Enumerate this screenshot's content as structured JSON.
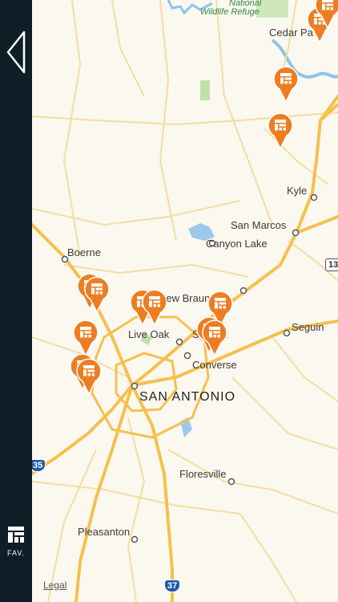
{
  "sidebar": {
    "fav_label": "FAV."
  },
  "map": {
    "places": {
      "wildlife": [
        "National",
        "Wildlife Refuge"
      ],
      "cedar_park": "Cedar Pa",
      "kyle": "Kyle",
      "san_marcos": "San Marcos",
      "canyon_lake": "Canyon Lake",
      "boerne": "Boerne",
      "new_braunfels": "New Braunfels",
      "seguin": "Seguin",
      "live_oak": "Live Oak",
      "schertz": "Schertz",
      "converse": "Converse",
      "san_antonio": "SAN ANTONIO",
      "floresville": "Floresville",
      "pleasanton": "Pleasanton"
    },
    "shields": {
      "i35": "35",
      "i37": "37",
      "r13": "13"
    },
    "legal": "Legal"
  },
  "colors": {
    "pin": "#ee7d22",
    "road_major": "#f6c04e",
    "road_minor": "#f2d58f",
    "sidebar": "#0f1e26"
  }
}
